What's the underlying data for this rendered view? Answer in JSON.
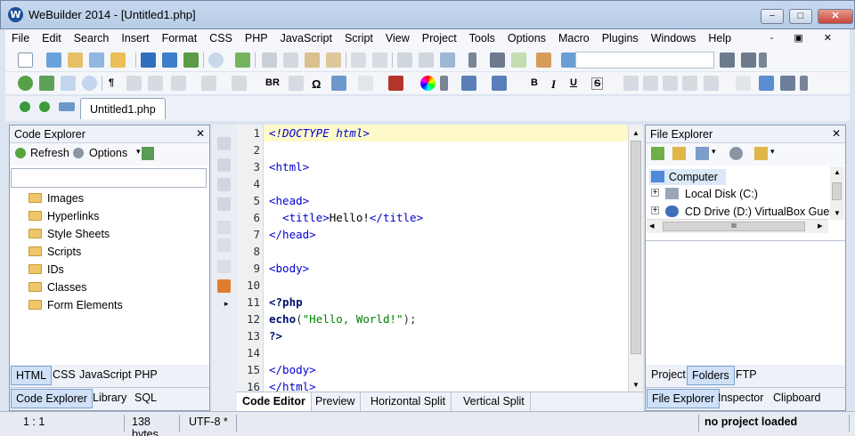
{
  "window": {
    "title": "WeBuilder 2014 - [Untitled1.php]",
    "logo_letter": "W",
    "minimize": "−",
    "maximize": "□",
    "close": "✕"
  },
  "menu": {
    "items": [
      "File",
      "Edit",
      "Search",
      "Insert",
      "Format",
      "CSS",
      "PHP",
      "JavaScript",
      "Script",
      "View",
      "Project",
      "Tools",
      "Options",
      "Macro",
      "Plugins",
      "Windows",
      "Help"
    ],
    "controls": "- ▣ ✕"
  },
  "toolbar2": {
    "bold_br": "BR",
    "omega": "Ω",
    "bold": "B",
    "underline": "U",
    "strike": "S"
  },
  "tabs": {
    "document": "Untitled1.php"
  },
  "code_explorer": {
    "title": "Code Explorer",
    "refresh_label": "Refresh",
    "options_label": "Options",
    "search_value": "",
    "items": [
      "Images",
      "Hyperlinks",
      "Style Sheets",
      "Scripts",
      "IDs",
      "Classes",
      "Form Elements"
    ],
    "lang_tabs": [
      "HTML",
      "CSS",
      "JavaScript",
      "PHP"
    ],
    "bottom_tabs": [
      "Code Explorer",
      "Library",
      "SQL"
    ]
  },
  "editor": {
    "line_numbers": [
      "1",
      "2",
      "3",
      "4",
      "5",
      "6",
      "7",
      "8",
      "9",
      "10",
      "11",
      "12",
      "13",
      "14",
      "15",
      "16"
    ],
    "lines": [
      [
        {
          "t": "<!DOCTYPE html>",
          "c": "tag",
          "i": true
        }
      ],
      [],
      [
        {
          "t": "<html>",
          "c": "tag"
        }
      ],
      [],
      [
        {
          "t": "<head>",
          "c": "tag"
        }
      ],
      [
        {
          "t": "  <title>",
          "c": "tag"
        },
        {
          "t": "Hello!",
          "c": ""
        },
        {
          "t": "</title>",
          "c": "tag"
        }
      ],
      [
        {
          "t": "</head>",
          "c": "tag"
        }
      ],
      [],
      [
        {
          "t": "<body>",
          "c": "tag"
        }
      ],
      [],
      [
        {
          "t": "<?php",
          "c": "kw"
        }
      ],
      [
        {
          "t": "echo",
          "c": "kw"
        },
        {
          "t": "(",
          "c": "punc"
        },
        {
          "t": "\"Hello, World!\"",
          "c": "str"
        },
        {
          "t": ");",
          "c": "punc"
        }
      ],
      [
        {
          "t": "?>",
          "c": "kw"
        }
      ],
      [],
      [
        {
          "t": "</body>",
          "c": "tag"
        }
      ],
      [
        {
          "t": "</html>",
          "c": "tag"
        }
      ]
    ],
    "view_tabs": [
      "Code Editor",
      "Preview",
      "Horizontal Split",
      "Vertical Split"
    ]
  },
  "file_explorer": {
    "title": "File Explorer",
    "tree": {
      "root": "Computer",
      "children": [
        "Local Disk (C:)",
        "CD Drive (D:) VirtualBox Guest A"
      ]
    },
    "scroll_arrows": {
      "left": "◂",
      "right": "▸",
      "grip": "III"
    },
    "tabs_top": [
      "Project",
      "Folders",
      "FTP"
    ],
    "tabs_bottom": [
      "File Explorer",
      "Inspector",
      "Clipboard"
    ]
  },
  "status": {
    "position": "1 : 1",
    "size": "138 bytes",
    "encoding": "UTF-8 *",
    "project": "no project loaded"
  },
  "colors": {
    "current_line": "#fdf9c9",
    "tag": "#0000d0",
    "string": "#008000",
    "keyword": "#001070"
  }
}
